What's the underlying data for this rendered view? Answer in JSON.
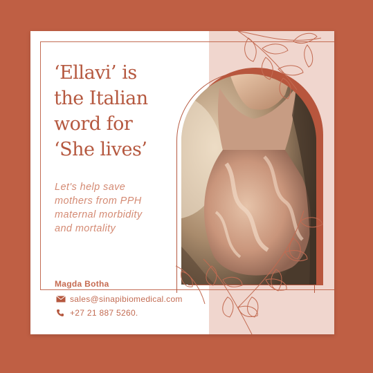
{
  "card": {
    "heading_lines": [
      "‘Ellavi’ is",
      "the Italian",
      "word for",
      "‘She lives’"
    ],
    "subtitle_lines": [
      "Let's help save",
      "mothers from PPH",
      "maternal morbidity",
      "and mortality"
    ],
    "contact": {
      "name": "Magda Botha",
      "email": "sales@sinapibiomedical.com",
      "phone": "+27 21 887 5260."
    }
  },
  "image": {
    "description_icon": "pregnant-woman-photo"
  },
  "colors": {
    "background": "#bf5f44",
    "accent": "#b5583f",
    "pink_panel": "#f0d6ce",
    "subtitle": "#d48a73"
  }
}
